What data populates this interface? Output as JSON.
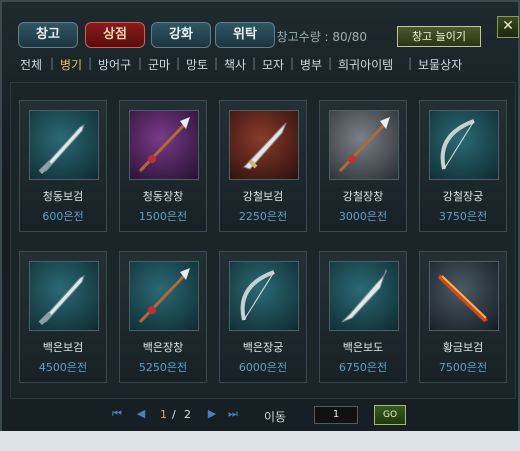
{
  "tabs": [
    {
      "label": "창고",
      "active": false
    },
    {
      "label": "상점",
      "active": true
    },
    {
      "label": "강화",
      "active": false
    },
    {
      "label": "위탁",
      "active": false
    }
  ],
  "capacity": {
    "label": "창고수량 : 80/80",
    "button": "창고 늘이기"
  },
  "close_label": "✕",
  "categories": [
    "전체",
    "병기",
    "방어구",
    "군마",
    "망토",
    "책사",
    "모자",
    "병부",
    "희귀아이템",
    "보물상자"
  ],
  "active_category": "병기",
  "items": [
    {
      "name": "청동보검",
      "price": "600은전",
      "art": "sword",
      "bg": "teal"
    },
    {
      "name": "청동장창",
      "price": "1500은전",
      "art": "spear",
      "bg": "purple"
    },
    {
      "name": "강철보검",
      "price": "2250은전",
      "art": "dagger",
      "bg": "red"
    },
    {
      "name": "강철장창",
      "price": "3000은전",
      "art": "spear",
      "bg": "gray"
    },
    {
      "name": "강철장궁",
      "price": "3750은전",
      "art": "bow",
      "bg": "teal"
    },
    {
      "name": "백은보검",
      "price": "4500은전",
      "art": "sword",
      "bg": "teal"
    },
    {
      "name": "백은장창",
      "price": "5250은전",
      "art": "spear",
      "bg": "teal"
    },
    {
      "name": "백은장궁",
      "price": "6000은전",
      "art": "bow",
      "bg": "teal"
    },
    {
      "name": "백은보도",
      "price": "6750은전",
      "art": "blade",
      "bg": "teal"
    },
    {
      "name": "황금보검",
      "price": "7500은전",
      "art": "fire",
      "bg": "dark"
    }
  ],
  "pager": {
    "first": "⏮",
    "prev": "◀",
    "current": "1",
    "sep": "/",
    "total": "2",
    "next": "▶",
    "last": "⏭",
    "move_label": "이동",
    "page_input": "1",
    "go_label": "GO"
  }
}
